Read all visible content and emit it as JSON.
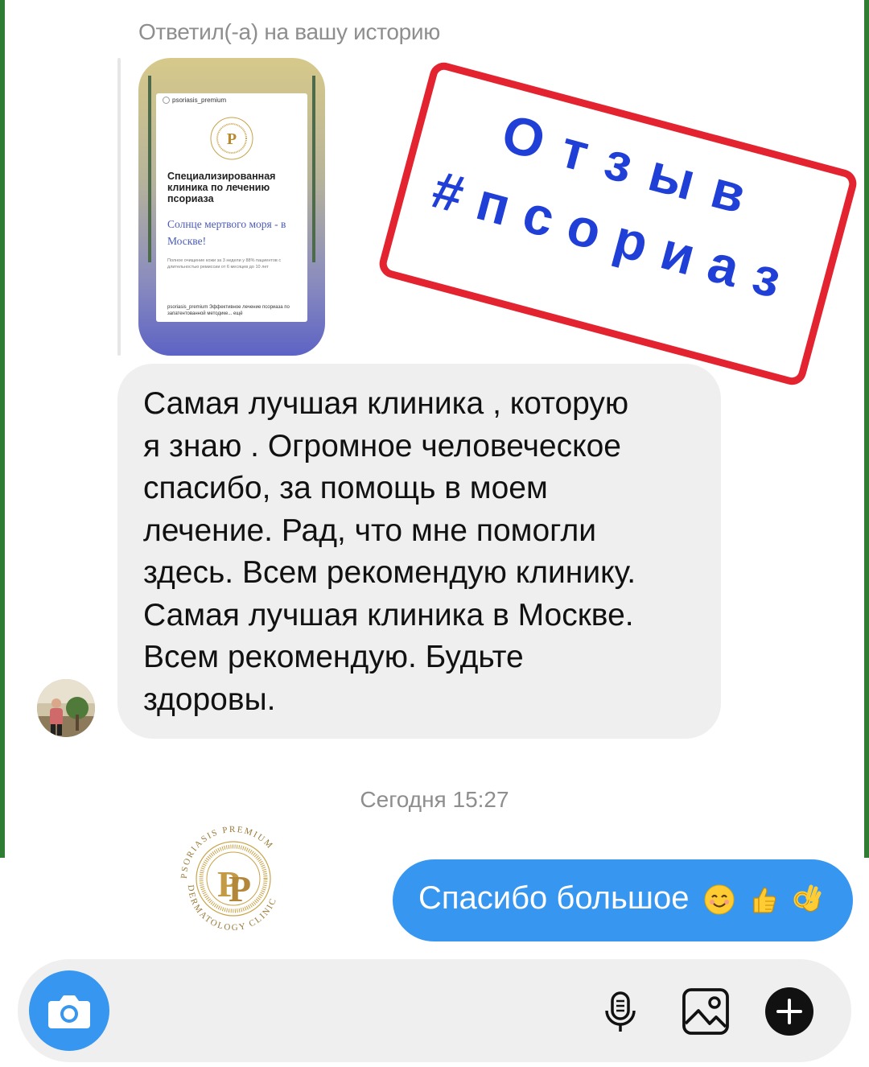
{
  "thread": {
    "reply_note": "Ответил(-а) на вашу историю",
    "timestamp": "Сегодня 15:27"
  },
  "story_preview": {
    "account": "psoriasis_premium",
    "headline": "Специализированная клиника по лечению псориаза",
    "subheadline": "Солнце мертвого моря - в Москве!",
    "fine_print": "Полное очищение кожи за 3 недели у 88% пациентов с длительностью ремиссии от 6 месяцев до 10 лет",
    "caption": "psoriasis_premium Эффективное лечение псориаза по запатентованной методике... ещё"
  },
  "stamp": {
    "line1": "Отзыв",
    "line2": "#псориаз",
    "border_color": "#e3232f",
    "text_color": "#1f3fd6"
  },
  "incoming_message": {
    "text": "Самая лучшая клиника , которую\nя знаю .  Огромное  человеческое\nспасибо, за помощь в моем\nлечение. Рад, что мне  помогли\nздесь. Всем рекомендую клинику.\nСамая лучшая клиника в Москве.\nВсем рекомендую.  Будьте\nздоровы."
  },
  "brand_logo": {
    "ring_text": "PSORIASIS PREMIUM DERMATOLOGY CLINIC"
  },
  "outgoing_message": {
    "text": "Спасибо большое",
    "emojis": [
      "smiling-face-icon",
      "thumbs-up-icon",
      "ok-hand-icon"
    ],
    "bubble_color": "#3797f0"
  },
  "composer": {
    "camera_icon": "camera-icon",
    "mic_icon": "microphone-icon",
    "gallery_icon": "image-icon",
    "add_icon": "plus-icon"
  }
}
